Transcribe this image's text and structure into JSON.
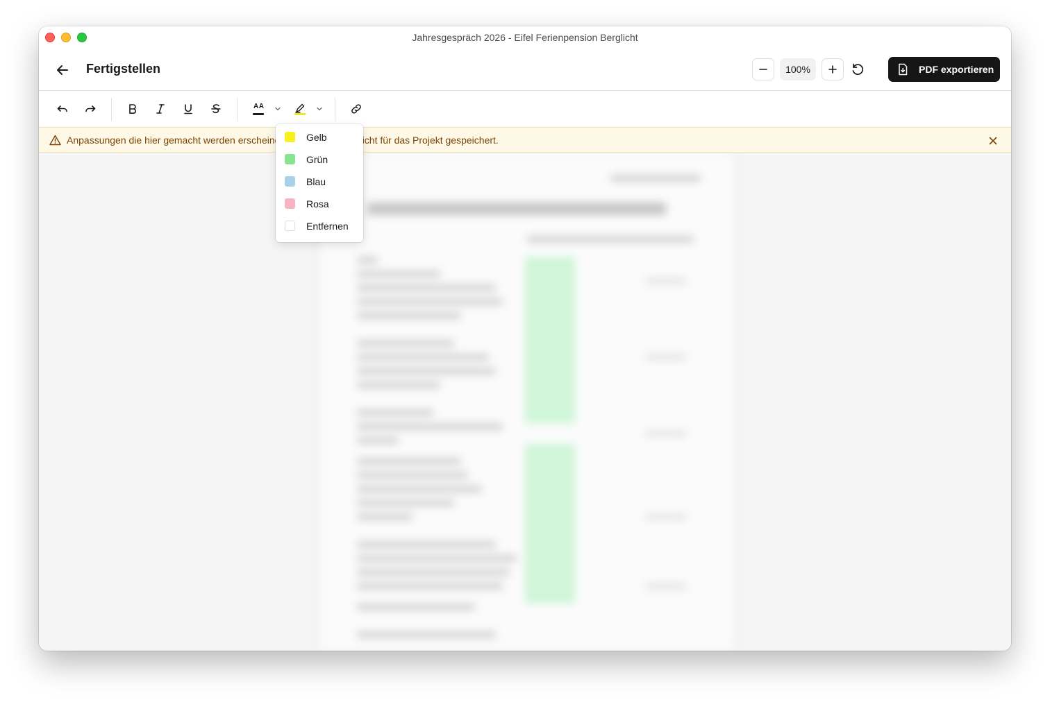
{
  "window": {
    "title": "Jahresgespräch 2026 - Eifel Ferienpension Berglicht"
  },
  "header": {
    "title": "Fertigstellen",
    "zoom_level": "100%",
    "export_label": "PDF exportieren"
  },
  "toolbar": {
    "text_size_glyph": "AA",
    "text_color": "#1a1a1a",
    "highlight_color": "#f5e81b",
    "icons": [
      "undo-icon",
      "redo-icon",
      "bold-icon",
      "italic-icon",
      "underline-icon",
      "strikethrough-icon",
      "text-size-icon",
      "chevron-down-icon",
      "highlighter-icon",
      "chevron-down-icon",
      "link-icon"
    ]
  },
  "banner": {
    "text": "Anpassungen die hier gemacht werden erscheinen im Export, aber nicht für das Projekt gespeichert."
  },
  "highlight_menu": {
    "items": [
      {
        "label": "Gelb",
        "color": "#f7f01f"
      },
      {
        "label": "Grün",
        "color": "#86e68f"
      },
      {
        "label": "Blau",
        "color": "#a9d1e6"
      },
      {
        "label": "Rosa",
        "color": "#f6b4c0"
      },
      {
        "label": "Entfernen",
        "color": "#ffffff"
      }
    ]
  },
  "colors": {
    "accent_dark": "#161616",
    "banner_bg": "#fef8e7",
    "banner_text": "#7a4407"
  }
}
